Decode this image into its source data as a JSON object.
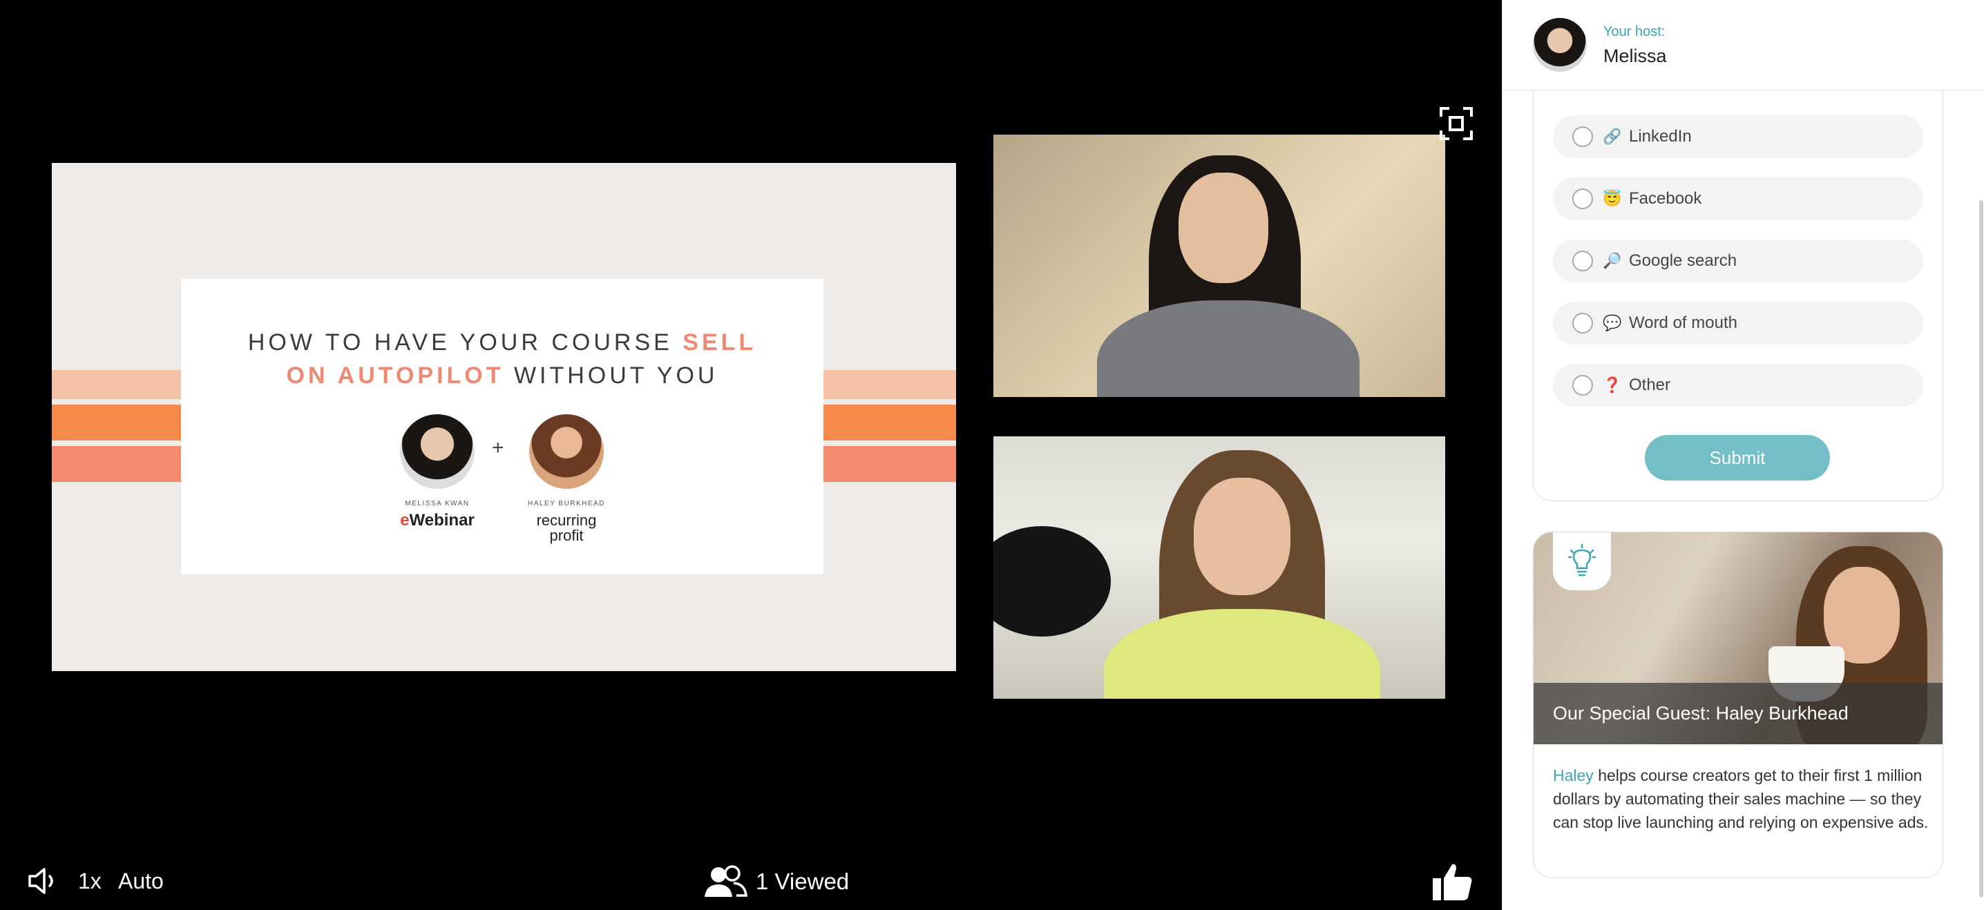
{
  "slide": {
    "title_part1": "HOW TO HAVE YOUR COURSE ",
    "title_highlight1": "SELL",
    "title_highlight2": "ON AUTOPILOT",
    "title_part2": " WITHOUT YOU",
    "presenter_a_name": "MELISSA KWAN",
    "presenter_a_logo_e": "e",
    "presenter_a_logo_rest": "Webinar",
    "presenter_b_name": "HALEY BURKHEAD",
    "presenter_b_logo": "recurring profit",
    "plus": "+"
  },
  "player": {
    "speed": "1x",
    "quality": "Auto",
    "viewers": "1 Viewed"
  },
  "host": {
    "caption": "Your host:",
    "name": "Melissa"
  },
  "poll": {
    "options": [
      {
        "emoji": "🔗",
        "label": "LinkedIn"
      },
      {
        "emoji": "😇",
        "label": "Facebook"
      },
      {
        "emoji": "🔎",
        "label": "Google search"
      },
      {
        "emoji": "💬",
        "label": "Word of mouth"
      },
      {
        "emoji": "❓",
        "label": "Other"
      }
    ],
    "submit_label": "Submit"
  },
  "guest": {
    "title": "Our Special Guest: Haley Burkhead",
    "desc_name": "Haley",
    "desc_rest": " helps course creators get to their first 1 million dollars by automating their sales machine — so they can stop live launching and relying on expensive ads."
  },
  "colors": {
    "accent": "#3ea3b6",
    "submit": "#74bec8",
    "slide_highlight": "#ec8a73"
  }
}
